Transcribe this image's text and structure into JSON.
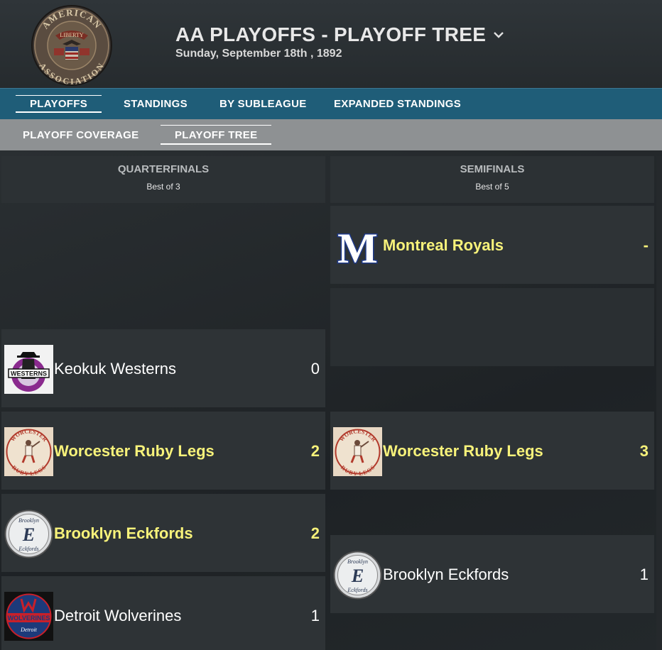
{
  "header": {
    "title": "AA PLAYOFFS - PLAYOFF TREE",
    "subtitle": "Sunday, September 18th , 1892",
    "logo_text_top": "AMERICAN",
    "logo_text_bottom": "ASSOCIATION",
    "logo_banner": "LIBERTY"
  },
  "nav_primary": {
    "tabs": [
      {
        "label": "PLAYOFFS",
        "active": true
      },
      {
        "label": "STANDINGS",
        "active": false
      },
      {
        "label": "BY SUBLEAGUE",
        "active": false
      },
      {
        "label": "EXPANDED STANDINGS",
        "active": false
      }
    ]
  },
  "nav_secondary": {
    "tabs": [
      {
        "label": "PLAYOFF COVERAGE",
        "active": false
      },
      {
        "label": "PLAYOFF TREE",
        "active": true
      }
    ]
  },
  "rounds": [
    {
      "name": "QUARTERFINALS",
      "series_length": "Best of 3"
    },
    {
      "name": "SEMIFINALS",
      "series_length": "Best of 5"
    }
  ],
  "quarterfinals": [
    {
      "team": "Keokuk Westerns",
      "score": "0",
      "winner": false,
      "logo": "westerns-logo"
    },
    {
      "team": "Worcester Ruby Legs",
      "score": "2",
      "winner": true,
      "logo": "worcester-logo"
    },
    {
      "team": "Brooklyn Eckfords",
      "score": "2",
      "winner": true,
      "logo": "brooklyn-logo"
    },
    {
      "team": "Detroit Wolverines",
      "score": "1",
      "winner": false,
      "logo": "detroit-logo"
    }
  ],
  "semifinals": [
    {
      "team": "Montreal Royals",
      "score": "-",
      "winner": true,
      "logo": "montreal-logo"
    },
    {
      "team": "Worcester Ruby Legs",
      "score": "3",
      "winner": true,
      "logo": "worcester-logo"
    },
    {
      "team": "Brooklyn Eckfords",
      "score": "1",
      "winner": false,
      "logo": "brooklyn-logo"
    }
  ],
  "logo_text": {
    "westerns": "WESTERNS",
    "worcester_top": "WORCESTER",
    "worcester_bottom": "RUBY LEGS",
    "brooklyn_top": "Brooklyn",
    "brooklyn_mid": "E",
    "brooklyn_bottom": "Eckfords",
    "detroit_mid": "WOLVERINES",
    "detroit_bottom": "Detroit",
    "montreal": "M"
  },
  "colors": {
    "winner_text": "#f7f27a",
    "nav_primary_bg": "#1f5d78",
    "nav_secondary_bg": "#8e9193"
  }
}
